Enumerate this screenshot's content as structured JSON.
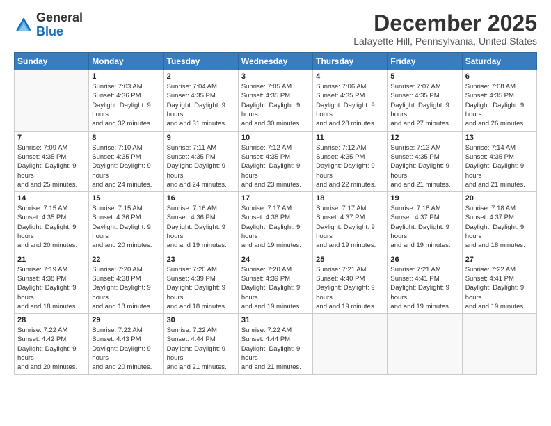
{
  "logo": {
    "general": "General",
    "blue": "Blue"
  },
  "header": {
    "month": "December 2025",
    "location": "Lafayette Hill, Pennsylvania, United States"
  },
  "weekdays": [
    "Sunday",
    "Monday",
    "Tuesday",
    "Wednesday",
    "Thursday",
    "Friday",
    "Saturday"
  ],
  "weeks": [
    [
      {
        "day": "",
        "sunrise": "",
        "sunset": "",
        "daylight": ""
      },
      {
        "day": "1",
        "sunrise": "Sunrise: 7:03 AM",
        "sunset": "Sunset: 4:36 PM",
        "daylight": "Daylight: 9 hours and 32 minutes."
      },
      {
        "day": "2",
        "sunrise": "Sunrise: 7:04 AM",
        "sunset": "Sunset: 4:35 PM",
        "daylight": "Daylight: 9 hours and 31 minutes."
      },
      {
        "day": "3",
        "sunrise": "Sunrise: 7:05 AM",
        "sunset": "Sunset: 4:35 PM",
        "daylight": "Daylight: 9 hours and 30 minutes."
      },
      {
        "day": "4",
        "sunrise": "Sunrise: 7:06 AM",
        "sunset": "Sunset: 4:35 PM",
        "daylight": "Daylight: 9 hours and 28 minutes."
      },
      {
        "day": "5",
        "sunrise": "Sunrise: 7:07 AM",
        "sunset": "Sunset: 4:35 PM",
        "daylight": "Daylight: 9 hours and 27 minutes."
      },
      {
        "day": "6",
        "sunrise": "Sunrise: 7:08 AM",
        "sunset": "Sunset: 4:35 PM",
        "daylight": "Daylight: 9 hours and 26 minutes."
      }
    ],
    [
      {
        "day": "7",
        "sunrise": "Sunrise: 7:09 AM",
        "sunset": "Sunset: 4:35 PM",
        "daylight": "Daylight: 9 hours and 25 minutes."
      },
      {
        "day": "8",
        "sunrise": "Sunrise: 7:10 AM",
        "sunset": "Sunset: 4:35 PM",
        "daylight": "Daylight: 9 hours and 24 minutes."
      },
      {
        "day": "9",
        "sunrise": "Sunrise: 7:11 AM",
        "sunset": "Sunset: 4:35 PM",
        "daylight": "Daylight: 9 hours and 24 minutes."
      },
      {
        "day": "10",
        "sunrise": "Sunrise: 7:12 AM",
        "sunset": "Sunset: 4:35 PM",
        "daylight": "Daylight: 9 hours and 23 minutes."
      },
      {
        "day": "11",
        "sunrise": "Sunrise: 7:12 AM",
        "sunset": "Sunset: 4:35 PM",
        "daylight": "Daylight: 9 hours and 22 minutes."
      },
      {
        "day": "12",
        "sunrise": "Sunrise: 7:13 AM",
        "sunset": "Sunset: 4:35 PM",
        "daylight": "Daylight: 9 hours and 21 minutes."
      },
      {
        "day": "13",
        "sunrise": "Sunrise: 7:14 AM",
        "sunset": "Sunset: 4:35 PM",
        "daylight": "Daylight: 9 hours and 21 minutes."
      }
    ],
    [
      {
        "day": "14",
        "sunrise": "Sunrise: 7:15 AM",
        "sunset": "Sunset: 4:35 PM",
        "daylight": "Daylight: 9 hours and 20 minutes."
      },
      {
        "day": "15",
        "sunrise": "Sunrise: 7:15 AM",
        "sunset": "Sunset: 4:36 PM",
        "daylight": "Daylight: 9 hours and 20 minutes."
      },
      {
        "day": "16",
        "sunrise": "Sunrise: 7:16 AM",
        "sunset": "Sunset: 4:36 PM",
        "daylight": "Daylight: 9 hours and 19 minutes."
      },
      {
        "day": "17",
        "sunrise": "Sunrise: 7:17 AM",
        "sunset": "Sunset: 4:36 PM",
        "daylight": "Daylight: 9 hours and 19 minutes."
      },
      {
        "day": "18",
        "sunrise": "Sunrise: 7:17 AM",
        "sunset": "Sunset: 4:37 PM",
        "daylight": "Daylight: 9 hours and 19 minutes."
      },
      {
        "day": "19",
        "sunrise": "Sunrise: 7:18 AM",
        "sunset": "Sunset: 4:37 PM",
        "daylight": "Daylight: 9 hours and 19 minutes."
      },
      {
        "day": "20",
        "sunrise": "Sunrise: 7:18 AM",
        "sunset": "Sunset: 4:37 PM",
        "daylight": "Daylight: 9 hours and 18 minutes."
      }
    ],
    [
      {
        "day": "21",
        "sunrise": "Sunrise: 7:19 AM",
        "sunset": "Sunset: 4:38 PM",
        "daylight": "Daylight: 9 hours and 18 minutes."
      },
      {
        "day": "22",
        "sunrise": "Sunrise: 7:20 AM",
        "sunset": "Sunset: 4:38 PM",
        "daylight": "Daylight: 9 hours and 18 minutes."
      },
      {
        "day": "23",
        "sunrise": "Sunrise: 7:20 AM",
        "sunset": "Sunset: 4:39 PM",
        "daylight": "Daylight: 9 hours and 18 minutes."
      },
      {
        "day": "24",
        "sunrise": "Sunrise: 7:20 AM",
        "sunset": "Sunset: 4:39 PM",
        "daylight": "Daylight: 9 hours and 19 minutes."
      },
      {
        "day": "25",
        "sunrise": "Sunrise: 7:21 AM",
        "sunset": "Sunset: 4:40 PM",
        "daylight": "Daylight: 9 hours and 19 minutes."
      },
      {
        "day": "26",
        "sunrise": "Sunrise: 7:21 AM",
        "sunset": "Sunset: 4:41 PM",
        "daylight": "Daylight: 9 hours and 19 minutes."
      },
      {
        "day": "27",
        "sunrise": "Sunrise: 7:22 AM",
        "sunset": "Sunset: 4:41 PM",
        "daylight": "Daylight: 9 hours and 19 minutes."
      }
    ],
    [
      {
        "day": "28",
        "sunrise": "Sunrise: 7:22 AM",
        "sunset": "Sunset: 4:42 PM",
        "daylight": "Daylight: 9 hours and 20 minutes."
      },
      {
        "day": "29",
        "sunrise": "Sunrise: 7:22 AM",
        "sunset": "Sunset: 4:43 PM",
        "daylight": "Daylight: 9 hours and 20 minutes."
      },
      {
        "day": "30",
        "sunrise": "Sunrise: 7:22 AM",
        "sunset": "Sunset: 4:44 PM",
        "daylight": "Daylight: 9 hours and 21 minutes."
      },
      {
        "day": "31",
        "sunrise": "Sunrise: 7:22 AM",
        "sunset": "Sunset: 4:44 PM",
        "daylight": "Daylight: 9 hours and 21 minutes."
      },
      {
        "day": "",
        "sunrise": "",
        "sunset": "",
        "daylight": ""
      },
      {
        "day": "",
        "sunrise": "",
        "sunset": "",
        "daylight": ""
      },
      {
        "day": "",
        "sunrise": "",
        "sunset": "",
        "daylight": ""
      }
    ]
  ]
}
